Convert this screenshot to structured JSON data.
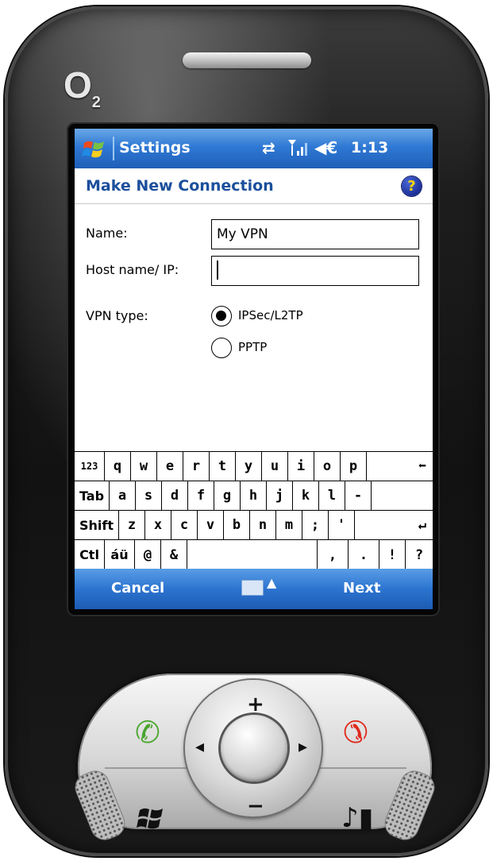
{
  "device": {
    "brand_logo": "O",
    "brand_logo_sub": "2"
  },
  "statusbar": {
    "start_icon": "windows-flag-icon",
    "title": "Settings",
    "sync_icon": "⇄",
    "volume_icon": "◀€",
    "time": "1:13"
  },
  "page": {
    "title": "Make New Connection",
    "help_glyph": "?"
  },
  "form": {
    "name_label": "Name:",
    "name_value": "My VPN",
    "host_label": "Host name/ IP:",
    "host_value": "",
    "vpn_type_label": "VPN type:",
    "vpn_options": [
      {
        "label": "IPSec/L2TP",
        "selected": true
      },
      {
        "label": "PPTP",
        "selected": false
      }
    ]
  },
  "keyboard": {
    "row1": [
      "123",
      "q",
      "w",
      "e",
      "r",
      "t",
      "y",
      "u",
      "i",
      "o",
      "p",
      "⬅"
    ],
    "row2": [
      "Tab",
      "a",
      "s",
      "d",
      "f",
      "g",
      "h",
      "j",
      "k",
      "l",
      "-"
    ],
    "row3": [
      "Shift",
      "z",
      "x",
      "c",
      "v",
      "b",
      "n",
      "m",
      ";",
      "'",
      "↵"
    ],
    "row4": [
      "Ctl",
      "áü",
      "@",
      "&",
      "",
      ",",
      ".",
      "!",
      "?"
    ]
  },
  "softkeys": {
    "left": "Cancel",
    "right": "Next",
    "input_panel_arrow": "▲"
  },
  "hardware": {
    "dpad_up": "+",
    "dpad_down": "−",
    "dpad_left": "◂",
    "dpad_right": "▸",
    "call_green": "✆",
    "call_red": "✆"
  },
  "colors": {
    "bar_blue": "#2f79d4",
    "title_blue": "#1b4f9c",
    "call_green": "#4aa52e",
    "call_red": "#e02a1e"
  }
}
